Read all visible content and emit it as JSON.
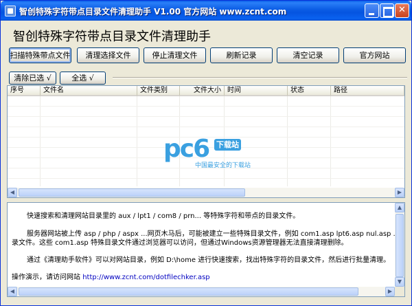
{
  "window": {
    "title": "智创特殊字符带点目录文件清理助手  V1.00  官方网站  www.zcnt.com"
  },
  "app": {
    "heading": "智创特殊字符带点目录文件清理助手"
  },
  "toolbar": {
    "buttons": [
      "扫描特殊带点文件",
      "清理选择文件",
      "停止清理文件",
      "刷新记录",
      "清空记录",
      "官方网站"
    ]
  },
  "selection": {
    "clear_label": "清除已选 √",
    "select_all_label": "全选 √"
  },
  "list": {
    "columns": [
      "序号",
      "文件名",
      "文件类别",
      "文件大小",
      "时间",
      "状态",
      "路径"
    ],
    "rows": []
  },
  "watermark": {
    "brand": "pc6",
    "badge": "下载站",
    "tagline": "中国最安全的下载站"
  },
  "description": {
    "line1": "快速搜索和清理网站目录里的 aux / lpt1 / com8 / prn... 等特殊字符和带点的目录文件。",
    "line2": "服务器网站被上传 asp / php / aspx ...网页木马后，可能被建立一些特殊目录文件，例如 com1.asp lpt6.asp nul.asp ...这种",
    "line3": "录文件。这些 com1.asp 特殊目录文件通过浏览器可以访问，但通过Windows资源管理器无法直接清理删除。",
    "line4": "通过《清理助手软件》可以对网站目录，例如 D:\\home 进行快速搜索，找出特殊字符的目录文件，然后进行批量清理。",
    "line5_prefix": "操作演示，请访问网站",
    "line5_url": "http://www.zcnt.com/dotfilechker.asp"
  },
  "colors": {
    "titlebar": "#0554e0",
    "window_bg": "#ece9d8",
    "watermark": "#3aa0e0",
    "link": "#0000c0"
  }
}
